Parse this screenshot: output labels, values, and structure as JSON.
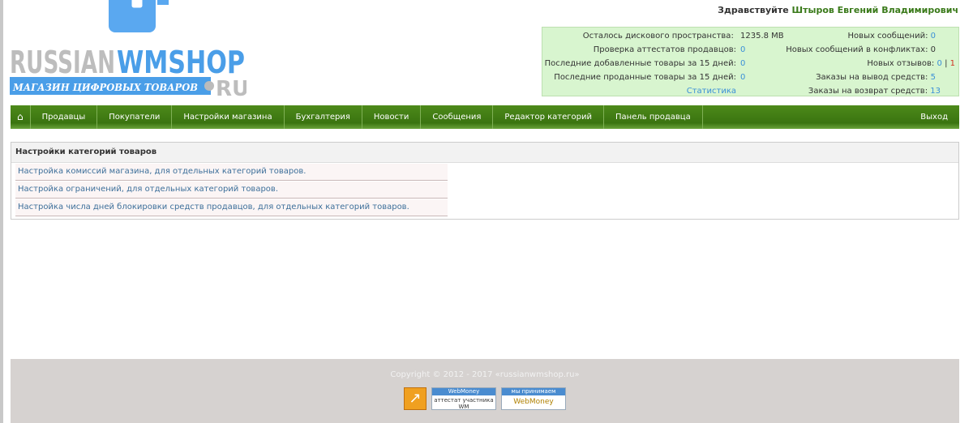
{
  "logo": {
    "text_main": "RUSSIANWMSHOP",
    "tagline": "МАГАЗИН ЦИФРОВЫХ ТОВАРОВ",
    "tld": ".RU"
  },
  "greeting": {
    "prefix": "Здравствуйте",
    "name": "Штыров Евгений Владимирович"
  },
  "stats": {
    "left": [
      {
        "label": "Осталось дискового пространства:",
        "value": "1235.8 MB"
      },
      {
        "label": "Проверка аттестатов продавцов:",
        "value": "0"
      },
      {
        "label": "Последние добавленные товары за 15 дней:",
        "value": "0"
      },
      {
        "label": "Последние проданные товары за 15 дней:",
        "value": "0"
      }
    ],
    "stats_link": "Статистика",
    "right": [
      {
        "label": "Новых сообщений:",
        "value": "0"
      },
      {
        "label": "Новых сообщений в конфликтах:",
        "value": "0"
      },
      {
        "label": "Новых отзывов:",
        "value": "0",
        "sep": "|",
        "value2": "1"
      },
      {
        "label": "Заказы на вывод средств:",
        "value": "5"
      },
      {
        "label": "Заказы на возврат средств:",
        "value": "13"
      }
    ]
  },
  "nav": {
    "items": [
      "Продавцы",
      "Покупатели",
      "Настройки магазина",
      "Бухгалтерия",
      "Новости",
      "Сообщения",
      "Редактор категорий",
      "Панель продавца"
    ],
    "exit": "Выход"
  },
  "panel": {
    "title": "Настройки категорий товаров",
    "links": [
      "Настройка комиссий магазина, для отдельных категорий товаров.",
      "Настройка ограничений, для отдельных категорий товаров.",
      "Настройка числа дней блокировки средств продавцов, для отдельных категорий товаров."
    ]
  },
  "footer": {
    "copyright": "Copyright © 2012 - 2017 «russianwmshop.ru»",
    "badge1_top": "WebMoney",
    "badge1_bottom": "аттестат участника WM",
    "badge2_top": "мы принимаем",
    "badge2_bottom": "WebMoney"
  },
  "colors": {
    "nav": "#3a7410",
    "stats_bg": "#d8f5cf",
    "link": "#3d6f9a"
  }
}
